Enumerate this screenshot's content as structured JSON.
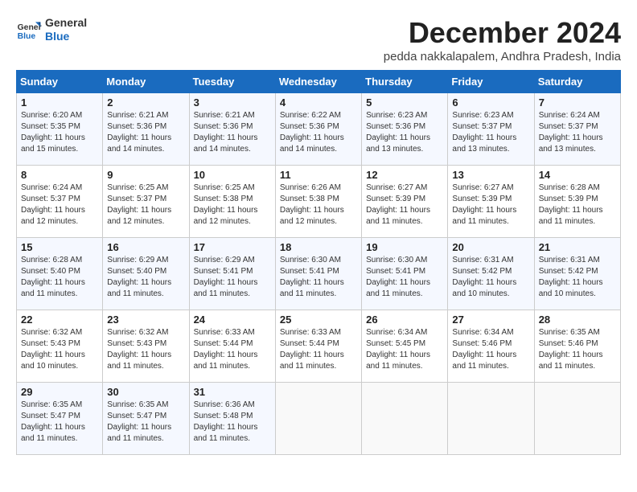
{
  "header": {
    "logo_line1": "General",
    "logo_line2": "Blue",
    "month_title": "December 2024",
    "subtitle": "pedda nakkalapalem, Andhra Pradesh, India"
  },
  "weekdays": [
    "Sunday",
    "Monday",
    "Tuesday",
    "Wednesday",
    "Thursday",
    "Friday",
    "Saturday"
  ],
  "weeks": [
    [
      {
        "day": "1",
        "sunrise": "6:20 AM",
        "sunset": "5:35 PM",
        "daylight": "11 hours and 15 minutes."
      },
      {
        "day": "2",
        "sunrise": "6:21 AM",
        "sunset": "5:36 PM",
        "daylight": "11 hours and 14 minutes."
      },
      {
        "day": "3",
        "sunrise": "6:21 AM",
        "sunset": "5:36 PM",
        "daylight": "11 hours and 14 minutes."
      },
      {
        "day": "4",
        "sunrise": "6:22 AM",
        "sunset": "5:36 PM",
        "daylight": "11 hours and 14 minutes."
      },
      {
        "day": "5",
        "sunrise": "6:23 AM",
        "sunset": "5:36 PM",
        "daylight": "11 hours and 13 minutes."
      },
      {
        "day": "6",
        "sunrise": "6:23 AM",
        "sunset": "5:37 PM",
        "daylight": "11 hours and 13 minutes."
      },
      {
        "day": "7",
        "sunrise": "6:24 AM",
        "sunset": "5:37 PM",
        "daylight": "11 hours and 13 minutes."
      }
    ],
    [
      {
        "day": "8",
        "sunrise": "6:24 AM",
        "sunset": "5:37 PM",
        "daylight": "11 hours and 12 minutes."
      },
      {
        "day": "9",
        "sunrise": "6:25 AM",
        "sunset": "5:37 PM",
        "daylight": "11 hours and 12 minutes."
      },
      {
        "day": "10",
        "sunrise": "6:25 AM",
        "sunset": "5:38 PM",
        "daylight": "11 hours and 12 minutes."
      },
      {
        "day": "11",
        "sunrise": "6:26 AM",
        "sunset": "5:38 PM",
        "daylight": "11 hours and 12 minutes."
      },
      {
        "day": "12",
        "sunrise": "6:27 AM",
        "sunset": "5:39 PM",
        "daylight": "11 hours and 11 minutes."
      },
      {
        "day": "13",
        "sunrise": "6:27 AM",
        "sunset": "5:39 PM",
        "daylight": "11 hours and 11 minutes."
      },
      {
        "day": "14",
        "sunrise": "6:28 AM",
        "sunset": "5:39 PM",
        "daylight": "11 hours and 11 minutes."
      }
    ],
    [
      {
        "day": "15",
        "sunrise": "6:28 AM",
        "sunset": "5:40 PM",
        "daylight": "11 hours and 11 minutes."
      },
      {
        "day": "16",
        "sunrise": "6:29 AM",
        "sunset": "5:40 PM",
        "daylight": "11 hours and 11 minutes."
      },
      {
        "day": "17",
        "sunrise": "6:29 AM",
        "sunset": "5:41 PM",
        "daylight": "11 hours and 11 minutes."
      },
      {
        "day": "18",
        "sunrise": "6:30 AM",
        "sunset": "5:41 PM",
        "daylight": "11 hours and 11 minutes."
      },
      {
        "day": "19",
        "sunrise": "6:30 AM",
        "sunset": "5:41 PM",
        "daylight": "11 hours and 11 minutes."
      },
      {
        "day": "20",
        "sunrise": "6:31 AM",
        "sunset": "5:42 PM",
        "daylight": "11 hours and 10 minutes."
      },
      {
        "day": "21",
        "sunrise": "6:31 AM",
        "sunset": "5:42 PM",
        "daylight": "11 hours and 10 minutes."
      }
    ],
    [
      {
        "day": "22",
        "sunrise": "6:32 AM",
        "sunset": "5:43 PM",
        "daylight": "11 hours and 10 minutes."
      },
      {
        "day": "23",
        "sunrise": "6:32 AM",
        "sunset": "5:43 PM",
        "daylight": "11 hours and 11 minutes."
      },
      {
        "day": "24",
        "sunrise": "6:33 AM",
        "sunset": "5:44 PM",
        "daylight": "11 hours and 11 minutes."
      },
      {
        "day": "25",
        "sunrise": "6:33 AM",
        "sunset": "5:44 PM",
        "daylight": "11 hours and 11 minutes."
      },
      {
        "day": "26",
        "sunrise": "6:34 AM",
        "sunset": "5:45 PM",
        "daylight": "11 hours and 11 minutes."
      },
      {
        "day": "27",
        "sunrise": "6:34 AM",
        "sunset": "5:46 PM",
        "daylight": "11 hours and 11 minutes."
      },
      {
        "day": "28",
        "sunrise": "6:35 AM",
        "sunset": "5:46 PM",
        "daylight": "11 hours and 11 minutes."
      }
    ],
    [
      {
        "day": "29",
        "sunrise": "6:35 AM",
        "sunset": "5:47 PM",
        "daylight": "11 hours and 11 minutes."
      },
      {
        "day": "30",
        "sunrise": "6:35 AM",
        "sunset": "5:47 PM",
        "daylight": "11 hours and 11 minutes."
      },
      {
        "day": "31",
        "sunrise": "6:36 AM",
        "sunset": "5:48 PM",
        "daylight": "11 hours and 11 minutes."
      },
      null,
      null,
      null,
      null
    ]
  ]
}
